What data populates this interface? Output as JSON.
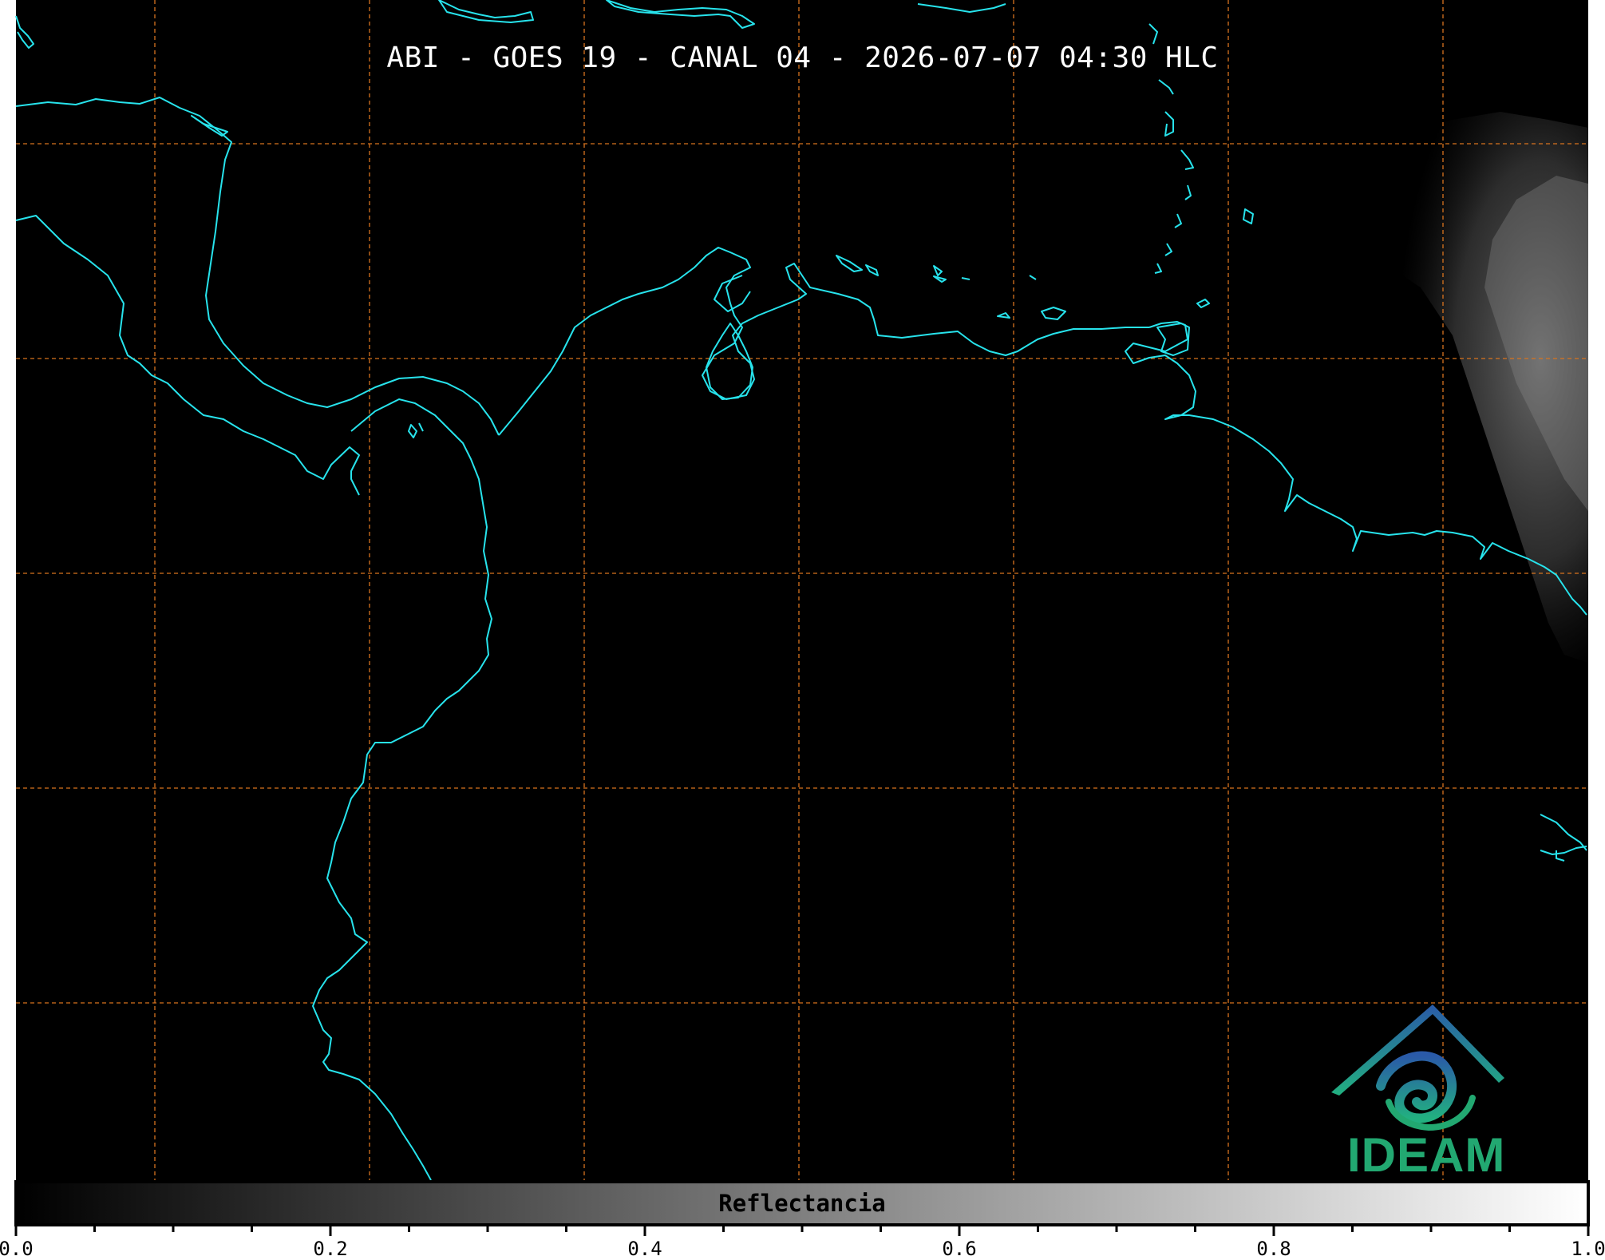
{
  "title": "ABI - GOES 19 - CANAL 04 - 2026-07-07 04:30 HLC",
  "colors": {
    "background": "#000000",
    "coastline": "#27e3ec",
    "gridline": "#d8731e",
    "cloud": "#6f6f6f",
    "logo_blue": "#2a5aa8",
    "logo_green": "#22a871"
  },
  "colorbar": {
    "label": "Reflectancia",
    "min": 0.0,
    "max": 1.0,
    "tick_labels": [
      "0.0",
      "0.2",
      "0.4",
      "0.6",
      "0.8",
      "1.0"
    ],
    "minor_tick_step": 0.05
  },
  "logo": {
    "text": "IDEAM",
    "icon": "ideam-mountain-spiral-logo"
  }
}
